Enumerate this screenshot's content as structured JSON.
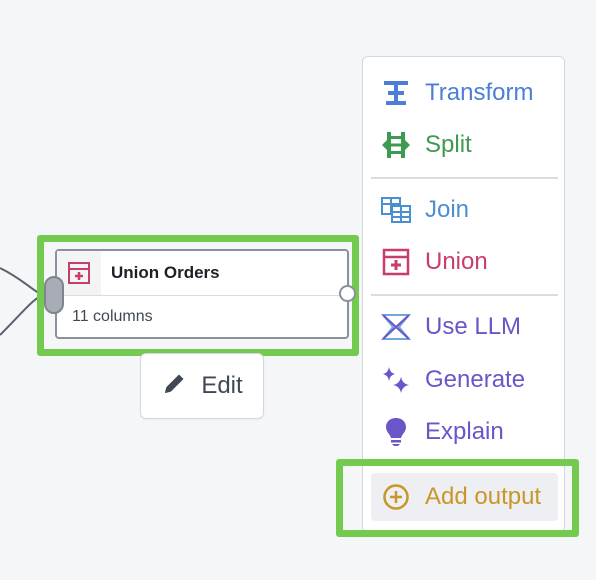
{
  "node": {
    "title": "Union Orders",
    "subtitle": "11 columns",
    "icon": "union-icon",
    "highlight_color": "#74c94f"
  },
  "edit_button": {
    "label": "Edit",
    "icon": "pencil-icon"
  },
  "menu": {
    "items": [
      {
        "label": "Transform",
        "icon": "transform-icon",
        "color": "#4c7ed8"
      },
      {
        "label": "Split",
        "icon": "split-icon",
        "color": "#3d9a50"
      },
      {
        "label": "Join",
        "icon": "join-icon",
        "color": "#4a8fd0"
      },
      {
        "label": "Union",
        "icon": "union-icon",
        "color": "#c93d6b"
      },
      {
        "label": "Use LLM",
        "icon": "llm-icon",
        "color": "#6b55c9"
      },
      {
        "label": "Generate",
        "icon": "sparkle-icon",
        "color": "#6b55c9"
      },
      {
        "label": "Explain",
        "icon": "lightbulb-icon",
        "color": "#6b55c9"
      },
      {
        "label": "Add output",
        "icon": "add-circle-icon",
        "color": "#c9962a"
      }
    ]
  }
}
